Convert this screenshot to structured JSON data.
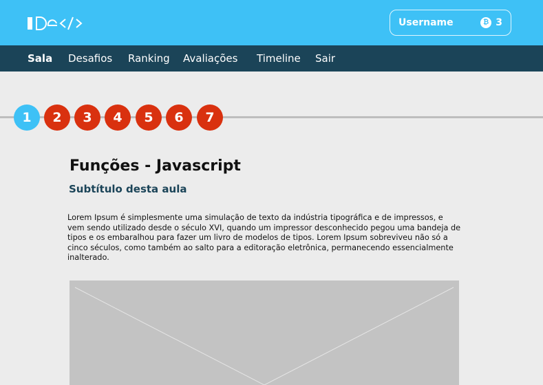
{
  "header": {
    "logo_text": "IDe</>",
    "username": "Username",
    "coin_icon": "bitcoin-icon",
    "coin_symbol": "₿",
    "coin_count": "3",
    "colors": {
      "topbar": "#3ec1f6",
      "navbar": "#1b4458"
    }
  },
  "nav": {
    "items": [
      {
        "label": "Sala",
        "active": true
      },
      {
        "label": "Desafios"
      },
      {
        "label": "Ranking"
      },
      {
        "label": "Avaliações"
      },
      {
        "label": "Timeline"
      },
      {
        "label": "Sair"
      }
    ]
  },
  "steps": {
    "items": [
      "1",
      "2",
      "3",
      "4",
      "5",
      "6",
      "7"
    ],
    "current": "1",
    "colors": {
      "current": "#3ec1f6",
      "other": "#d9310f"
    }
  },
  "lesson": {
    "title": "Funções - Javascript",
    "subtitle": "Subtítulo desta aula",
    "body": "Lorem Ipsum é simplesmente uma simulação de texto da indústria tipográfica e de impressos, e vem sendo utilizado desde o século XVI, quando um impressor desconhecido pegou uma bandeja de tipos e os embaralhou para fazer um livro de modelos de tipos. Lorem Ipsum sobreviveu não só a cinco séculos, como também ao salto para a editoração eletrônica, permanecendo essencialmente inalterado.",
    "media_icon": "image-placeholder-icon"
  }
}
